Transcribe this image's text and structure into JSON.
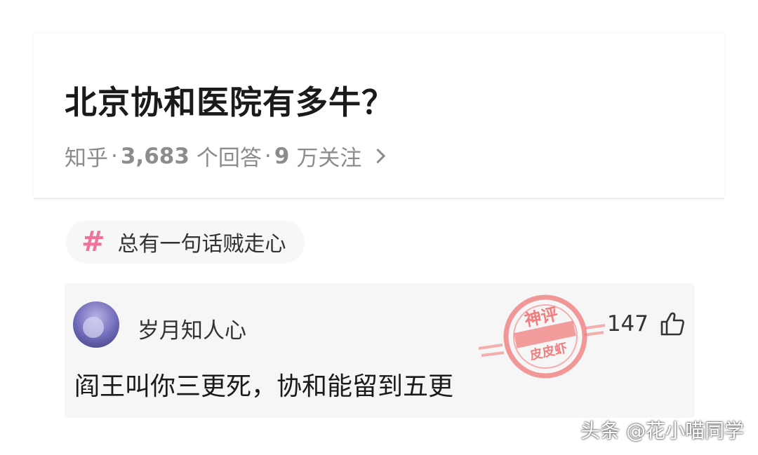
{
  "question": {
    "title": "北京协和医院有多牛？",
    "source": "知乎",
    "sep": "·",
    "answers_count": "3,683",
    "answers_label": "个回答",
    "followers_count": "9",
    "followers_label": "万关注"
  },
  "topic": {
    "label": "总有一句话贼走心",
    "icon": "hash-icon"
  },
  "comment": {
    "user_name": "岁月知人心",
    "likes": "147",
    "text": "阎王叫你三更死，协和能留到五更"
  },
  "stamp": {
    "line1": "神评",
    "line2": "皮皮虾",
    "color": "#f06a6a"
  },
  "watermark": "头条 @花小喵同学",
  "colors": {
    "accent_pink": "#f0719a",
    "meta_gray": "#8c8c8c",
    "comment_bg": "#f6f6f6"
  }
}
